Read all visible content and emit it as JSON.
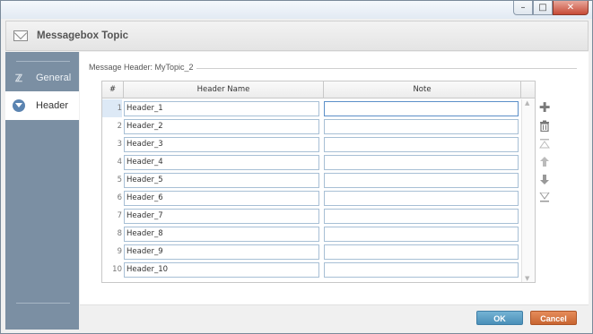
{
  "window": {
    "title": "Messagebox Topic",
    "controls": {
      "minimize_icon": "minimize-icon",
      "maximize_icon": "maximize-icon",
      "close_icon": "close-icon"
    }
  },
  "sidebar": {
    "items": [
      {
        "label": "General",
        "icon": "general-icon",
        "active": false
      },
      {
        "label": "Header",
        "icon": "header-icon",
        "active": true
      }
    ]
  },
  "main": {
    "group_label": "Message Header: MyTopic_2",
    "columns": [
      "#",
      "Header Name",
      "Note"
    ],
    "rows": [
      {
        "num": "1",
        "name": "Header_1",
        "note": ""
      },
      {
        "num": "2",
        "name": "Header_2",
        "note": ""
      },
      {
        "num": "3",
        "name": "Header_3",
        "note": ""
      },
      {
        "num": "4",
        "name": "Header_4",
        "note": ""
      },
      {
        "num": "5",
        "name": "Header_5",
        "note": ""
      },
      {
        "num": "6",
        "name": "Header_6",
        "note": ""
      },
      {
        "num": "7",
        "name": "Header_7",
        "note": ""
      },
      {
        "num": "8",
        "name": "Header_8",
        "note": ""
      },
      {
        "num": "9",
        "name": "Header_9",
        "note": ""
      },
      {
        "num": "10",
        "name": "Header_10",
        "note": ""
      }
    ],
    "selected_row": 1,
    "tools": [
      "add-icon",
      "delete-icon",
      "move-top-icon",
      "move-up-icon",
      "move-down-icon",
      "move-bottom-icon"
    ]
  },
  "footer": {
    "ok_label": "OK",
    "cancel_label": "Cancel"
  },
  "colors": {
    "sidebar_bg": "#7b8fa3",
    "ok_button": "#4a8fb8",
    "cancel_button": "#c86531",
    "selection": "#dde9f6"
  }
}
